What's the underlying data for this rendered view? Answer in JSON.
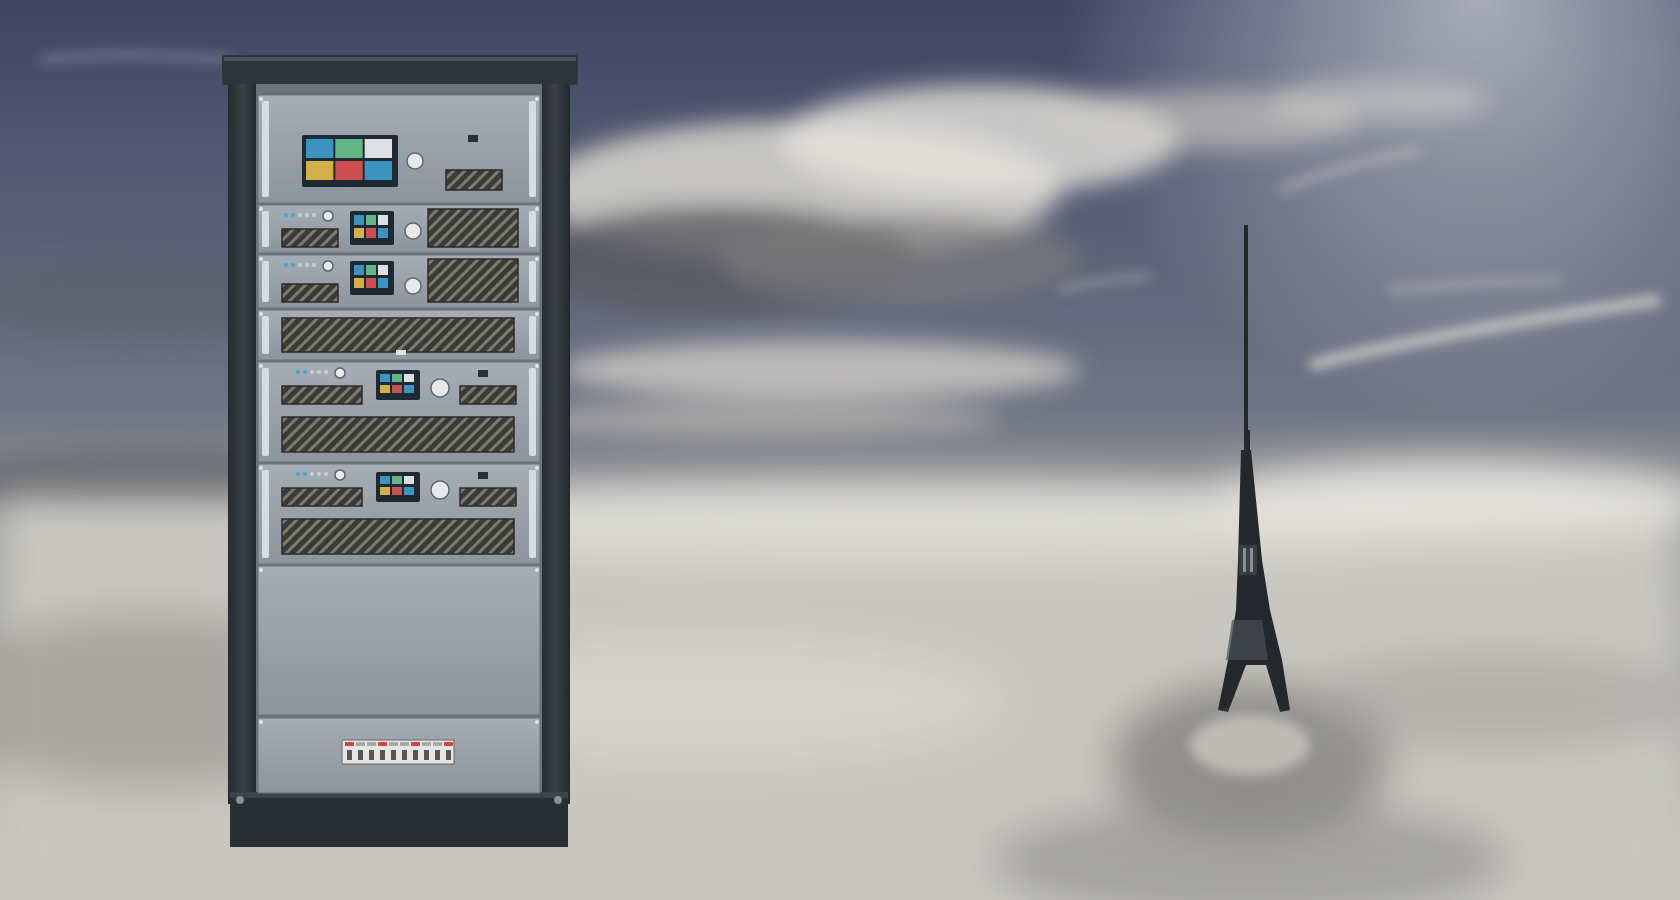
{
  "scene": {
    "sky_top": "#3e4663",
    "sky_mid": "#6f7585",
    "horizon": "#9a9a98",
    "fog": "#c8c6c0",
    "fog_shadow": "#8f8e8a",
    "cloud_light": "#e6e3dc",
    "cloud_dark": "#5a5b60"
  },
  "cabinet": {
    "frame_color": "#2f3539",
    "panel_color": "#8c949c",
    "panel_light": "#a6adb4",
    "grille_color": "#3a3a36",
    "screen_color": "#1d2a33",
    "units": [
      {
        "kind": "controller"
      },
      {
        "kind": "amplifier-small"
      },
      {
        "kind": "amplifier-small"
      },
      {
        "kind": "grille-panel"
      },
      {
        "kind": "amplifier-large"
      },
      {
        "kind": "amplifier-large"
      },
      {
        "kind": "blank-panel"
      },
      {
        "kind": "breaker-panel"
      }
    ]
  },
  "tower": {
    "color": "#24282c"
  }
}
